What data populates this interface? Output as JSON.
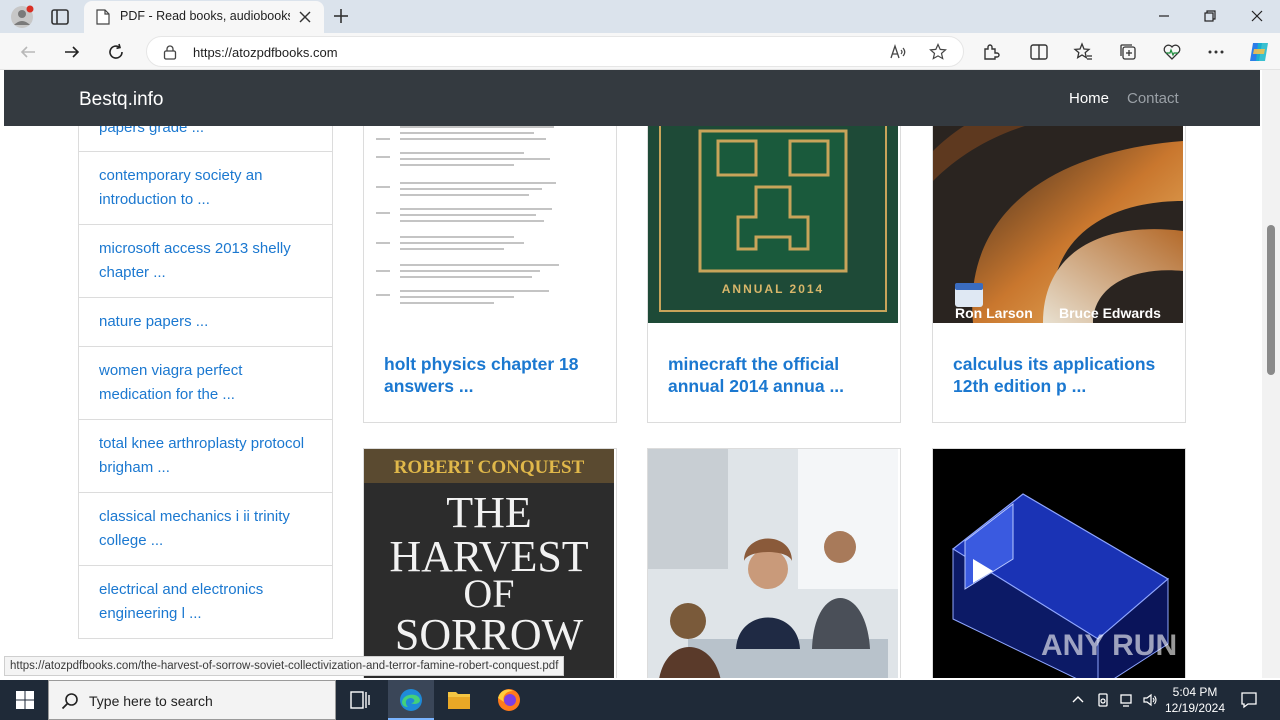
{
  "browser": {
    "tab_title": "PDF - Read books, audiobooks, a",
    "url": "https://atozpdfbooks.com",
    "status_url": "https://atozpdfbooks.com/the-harvest-of-sorrow-soviet-collectivization-and-terror-famine-robert-conquest.pdf"
  },
  "site": {
    "brand": "Bestq.info",
    "nav": [
      {
        "label": "Home",
        "color": "#ffffff"
      },
      {
        "label": "Contact",
        "color": "#9aa0a6"
      }
    ]
  },
  "sidebar": {
    "items": [
      {
        "label": "papers grade ..."
      },
      {
        "label": "contemporary society an introduction to ..."
      },
      {
        "label": "microsoft access 2013 shelly chapter ..."
      },
      {
        "label": "nature papers ..."
      },
      {
        "label": "women viagra perfect medication for the ..."
      },
      {
        "label": "total knee arthroplasty protocol brigham ..."
      },
      {
        "label": "classical mechanics i ii trinity college ..."
      },
      {
        "label": "electrical and electronics engineering l ..."
      }
    ]
  },
  "cards": [
    {
      "title": "holt physics chapter 18 answers ..."
    },
    {
      "title": "minecraft the official annual 2014 annua ..."
    },
    {
      "title": "calculus its applications 12th edition p ...",
      "cover_authors": [
        "Ron Larson",
        "Bruce Edwards"
      ]
    },
    {
      "cover_lines": [
        "ROBERT CONQUEST",
        "THE",
        "HARVEST",
        "OF",
        "SORROW"
      ]
    },
    {},
    {}
  ],
  "minecraft_cover": {
    "caption": "ANNUAL 2014"
  },
  "watermark": {
    "text": "ANY RUN"
  },
  "taskbar": {
    "search_placeholder": "Type here to search",
    "time": "5:04 PM",
    "date": "12/19/2024"
  },
  "colors": {
    "link": "#1b78d0",
    "navbar": "#343a40",
    "taskbar": "#1f2a38"
  }
}
